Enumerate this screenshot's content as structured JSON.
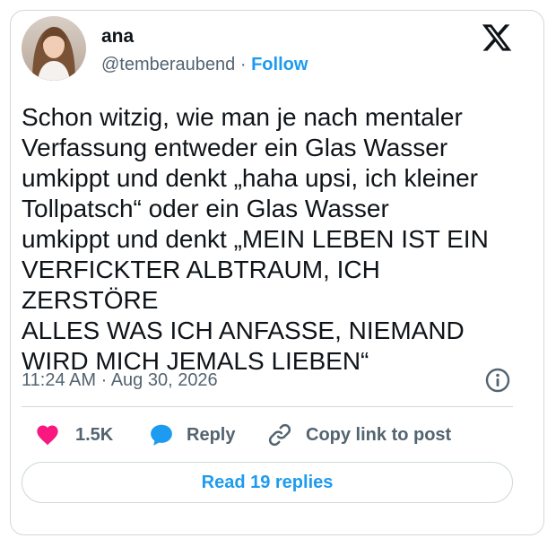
{
  "author": {
    "name": "ana",
    "handle": "@temberaubend",
    "separator": "·",
    "follow_label": "Follow"
  },
  "tweet": {
    "text": "Schon witzig, wie man je nach mentaler\nVerfassung entweder ein Glas Wasser\numkippt und denkt „haha upsi, ich kleiner\nTollpatsch“ oder ein Glas Wasser\numkippt und denkt „MEIN LEBEN IST EIN\nVERFICKTER ALBTRAUM, ICH ZERSTÖRE\nALLES WAS ICH ANFASSE, NIEMAND\nWIRD MICH JEMALS LIEBEN“",
    "timestamp": "11:24 AM · Aug 30, 2026"
  },
  "actions": {
    "likes": "1.5K",
    "reply_label": "Reply",
    "copy_label": "Copy link to post",
    "read_replies_label": "Read 19 replies"
  },
  "icons": {
    "brand": "x-logo-icon",
    "info": "info-icon",
    "like": "heart-icon",
    "reply": "speech-bubble-icon",
    "copy": "link-icon"
  },
  "colors": {
    "accent": "#1d9bf0",
    "like": "#f91880",
    "text": "#0f1419",
    "muted": "#536471",
    "border": "#cfd9de"
  }
}
